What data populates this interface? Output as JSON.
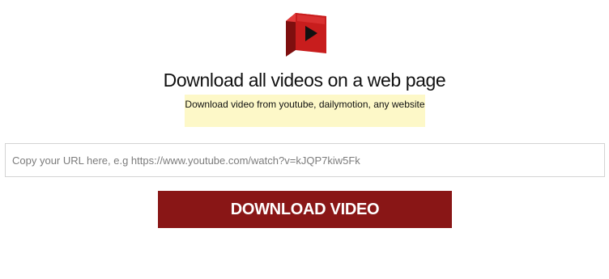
{
  "logo": {
    "icon": "play-box-icon",
    "color": "#cc1f1f"
  },
  "header": {
    "title": "Download all videos on a web page",
    "subtitle": "Download video from youtube, dailymotion, any website"
  },
  "form": {
    "url_placeholder": "Copy your URL here, e.g https://www.youtube.com/watch?v=kJQP7kiw5Fk",
    "url_value": "",
    "download_label": "DOWNLOAD VIDEO"
  },
  "colors": {
    "button": "#891616",
    "highlight": "#fdf8c8"
  }
}
